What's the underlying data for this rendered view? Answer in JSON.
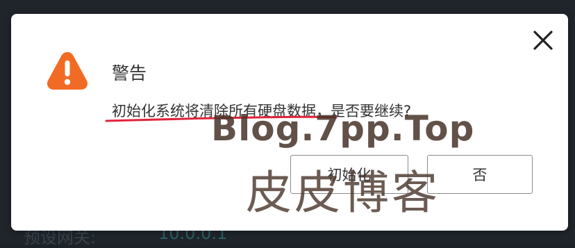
{
  "background": {
    "label": "预设网关:",
    "value": "10.0.0.1"
  },
  "dialog": {
    "title": "警告",
    "message": "初始化系统将清除所有硬盘数据，是否要继续?",
    "buttons": {
      "confirm_label": "初始化",
      "cancel_label": "否"
    },
    "icons": {
      "close": "close-icon",
      "warning": "warning-icon"
    }
  },
  "watermark": {
    "line1": "Blog.7pp.Top",
    "line2": "皮皮博客"
  },
  "colors": {
    "warning_orange": "#f26b24",
    "annotation_red": "#e0243b",
    "text": "#333333"
  }
}
